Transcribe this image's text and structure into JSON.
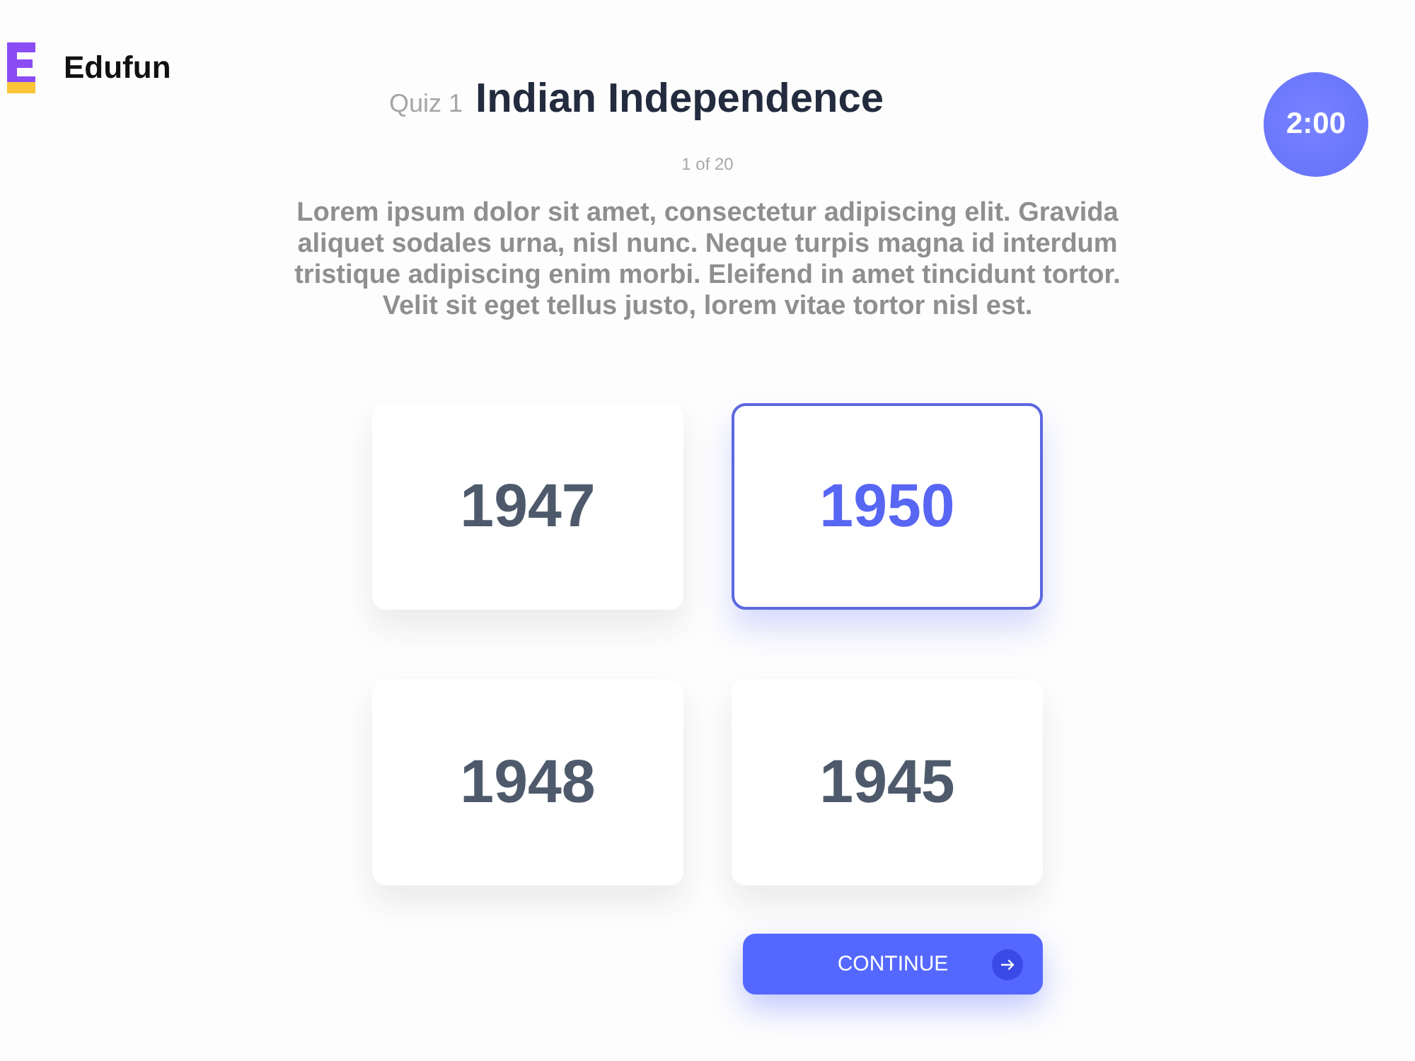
{
  "brand": {
    "name": "Edufun"
  },
  "header": {
    "quiz_label": "Quiz 1",
    "title": "Indian Independence",
    "progress": "1 of 20"
  },
  "timer": {
    "time": "2:00"
  },
  "question": {
    "text": "Lorem ipsum dolor sit amet, consectetur adipiscing elit. Gravida aliquet sodales urna, nisl nunc. Neque turpis magna id interdum tristique adipiscing enim morbi. Eleifend in amet tincidunt tortor. Velit sit eget tellus justo, lorem vitae tortor nisl est."
  },
  "options": [
    {
      "label": "1947",
      "selected": false
    },
    {
      "label": "1950",
      "selected": true
    },
    {
      "label": "1948",
      "selected": false
    },
    {
      "label": "1945",
      "selected": false
    }
  ],
  "continue_button": {
    "label": "CONTINUE"
  }
}
